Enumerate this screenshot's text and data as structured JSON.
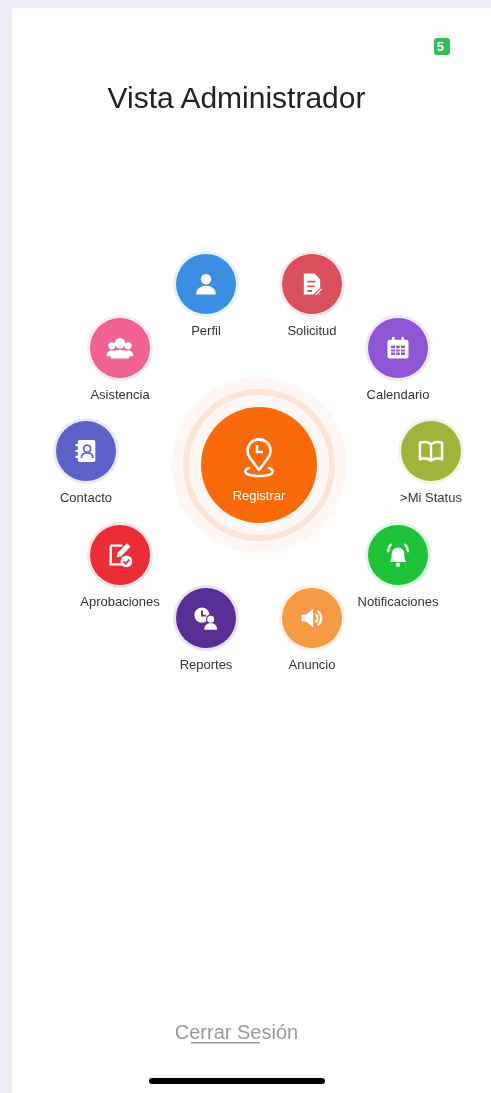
{
  "badge": "5",
  "title": "Vista Administrador",
  "center_button": {
    "label": "Registrar"
  },
  "menu_items": [
    {
      "label": "Perfil",
      "color": "#3b8ee0"
    },
    {
      "label": "Solicitud",
      "color": "#d94f5c"
    },
    {
      "label": "Asistencia",
      "color": "#f06292"
    },
    {
      "label": "Calendario",
      "color": "#8e55d4"
    },
    {
      "label": "Contacto",
      "color": "#5c62c8"
    },
    {
      "label": ">Mi Status",
      "color": "#a0b33a"
    },
    {
      "label": "Aprobaciones",
      "color": "#ea2d36"
    },
    {
      "label": "Notificaciones",
      "color": "#1fc33a"
    },
    {
      "label": "Reportes",
      "color": "#5a2d95"
    },
    {
      "label": "Anuncio",
      "color": "#f59a45"
    }
  ],
  "logout": "Cerrar Sesión"
}
